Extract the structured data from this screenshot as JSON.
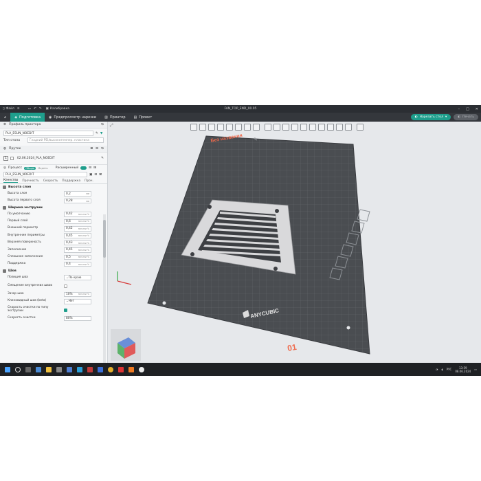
{
  "titlebar": {
    "file_label": "Файл",
    "calibration_label": "Калибровка",
    "title": "FAN_TOP_END_00.05"
  },
  "tabs": [
    {
      "label": "Подготовка",
      "active": true
    },
    {
      "label": "Предпросмотр нарезки",
      "active": false
    },
    {
      "label": "Принтер",
      "active": false
    },
    {
      "label": "Проект",
      "active": false
    }
  ],
  "actions": {
    "slice_label": "Нарезать стол",
    "print_label": "Печать"
  },
  "printer": {
    "section_label": "Профиль принтера",
    "name": "PLA_ESUN_NOEDIT",
    "bed_label": "Тип стола",
    "bed_value": "Гладкий PEI/высокотемпер. пластина"
  },
  "filament": {
    "section_label": "Пруток",
    "slot": "1",
    "name": "02.06.2024_PLA_NOEDIT"
  },
  "process": {
    "label": "Процесс",
    "toggle_general": "Общие",
    "toggle_model": "Модель",
    "advanced_label": "Расширенный",
    "name": "PLA_ESUN_NOEDIT"
  },
  "subtabs": [
    "Качество",
    "Прочность",
    "Скорость",
    "Поддержка",
    "Проч."
  ],
  "groups": [
    {
      "title": "Высота слоя",
      "rows": [
        {
          "label": "Высота слоя",
          "value": "0,2",
          "unit": "мм"
        },
        {
          "label": "Высота первого слоя",
          "value": "0,28",
          "unit": "мм"
        }
      ]
    },
    {
      "title": "Ширина экструзии",
      "rows": [
        {
          "label": "По умолчанию",
          "value": "0,42",
          "unit": "мм или %"
        },
        {
          "label": "Первый слой",
          "value": "0,6",
          "unit": "мм или %"
        },
        {
          "label": "Внешний периметр",
          "value": "0,42",
          "unit": "мм или %"
        },
        {
          "label": "Внутренние периметры",
          "value": "0,45",
          "unit": "мм или %"
        },
        {
          "label": "Верхняя поверхность",
          "value": "0,43",
          "unit": "мм или %"
        },
        {
          "label": "Заполнение",
          "value": "0,45",
          "unit": "мм или %"
        },
        {
          "label": "Сплошное заполнение",
          "value": "0,5",
          "unit": "мм или %"
        },
        {
          "label": "Поддержка",
          "value": "0,4",
          "unit": "мм или %"
        }
      ]
    },
    {
      "title": "Шов",
      "rows": [
        {
          "label": "Позиция шва",
          "value": "По краю",
          "unit": ""
        },
        {
          "label": "Смещение внутренних швов",
          "value": "",
          "unit": "",
          "checkbox": false
        },
        {
          "label": "Зазор шва",
          "value": "10%",
          "unit": "мм или %"
        },
        {
          "label": "Клиновидный шов (beta)",
          "value": "Нет",
          "unit": ""
        },
        {
          "label": "Скорость очистки по типу экструзии",
          "value": "",
          "unit": "",
          "checkbox": true
        },
        {
          "label": "Скорость очистки",
          "value": "80%",
          "unit": ""
        }
      ]
    }
  ],
  "viewport": {
    "plate_name": "Без названия",
    "plate_number": "01",
    "brand": "ANYCUBIC"
  },
  "taskbar": {
    "lang": "РУС",
    "time": "13:59",
    "date": "08.06.2024"
  }
}
